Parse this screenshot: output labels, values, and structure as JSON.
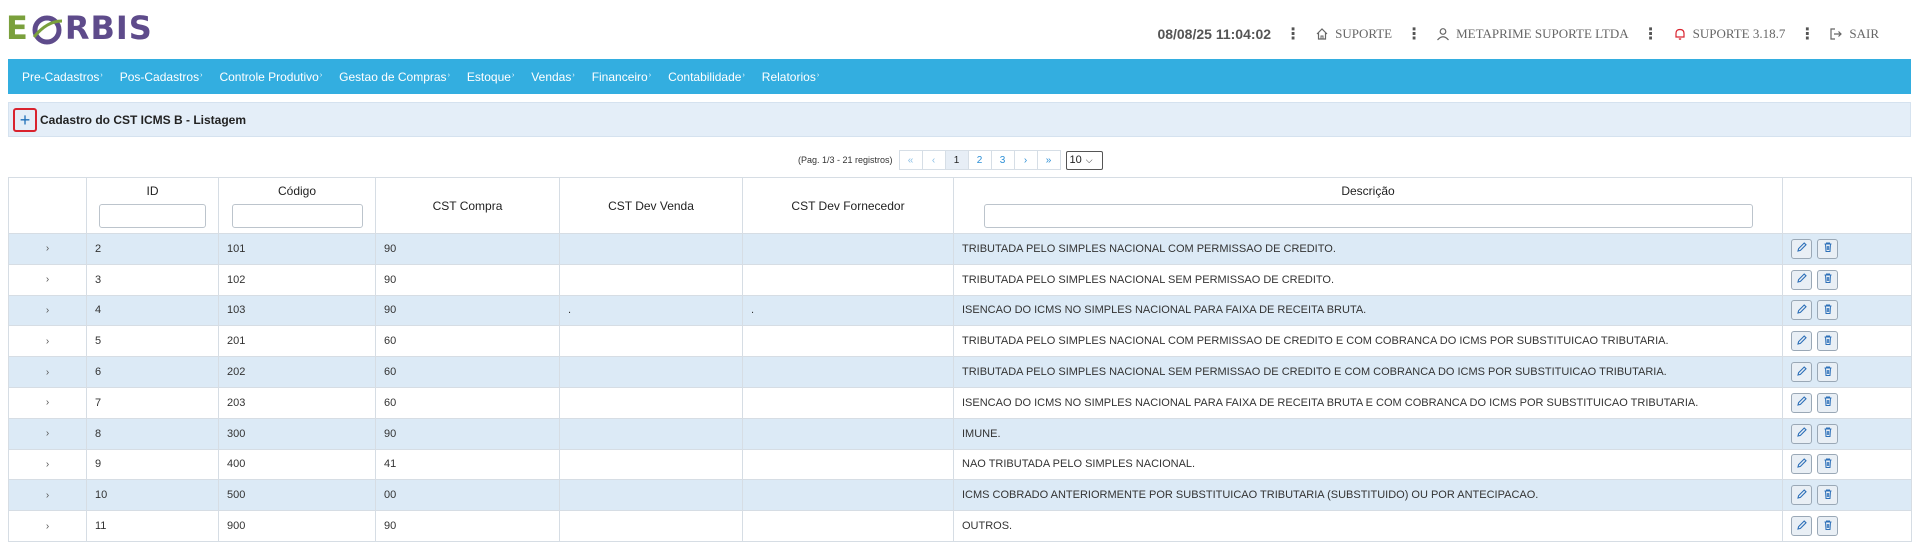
{
  "logo": {
    "letter_e": "E",
    "rest": "RBIS"
  },
  "header": {
    "datetime": "08/08/25 11:04:02",
    "support_label": "SUPORTE",
    "company": "METAPRIME SUPORTE LTDA",
    "version": "SUPORTE 3.18.7",
    "logout": "SAIR"
  },
  "menu": [
    {
      "label": "Pre-Cadastros"
    },
    {
      "label": "Pos-Cadastros"
    },
    {
      "label": "Controle Produtivo"
    },
    {
      "label": "Gestao de Compras"
    },
    {
      "label": "Estoque"
    },
    {
      "label": "Vendas"
    },
    {
      "label": "Financeiro"
    },
    {
      "label": "Contabilidade"
    },
    {
      "label": "Relatorios"
    }
  ],
  "page": {
    "add_symbol": "+",
    "title": "Cadastro do CST ICMS B - Listagem"
  },
  "pager": {
    "info": "(Pag. 1/3 - 21 registros)",
    "first": "«",
    "prev": "‹",
    "pages": [
      "1",
      "2",
      "3"
    ],
    "current_page": "1",
    "next": "›",
    "last": "»",
    "page_size": "10"
  },
  "table": {
    "headers": {
      "id": "ID",
      "codigo": "Código",
      "cst_compra": "CST Compra",
      "cst_dev_venda": "CST Dev Venda",
      "cst_dev_fornecedor": "CST Dev Fornecedor",
      "descricao": "Descrição"
    },
    "rows": [
      {
        "id": "2",
        "codigo": "101",
        "cst_compra": "90",
        "cst_dev_venda": "",
        "cst_dev_fornecedor": "",
        "descricao": "TRIBUTADA PELO SIMPLES NACIONAL COM PERMISSAO DE CREDITO."
      },
      {
        "id": "3",
        "codigo": "102",
        "cst_compra": "90",
        "cst_dev_venda": "",
        "cst_dev_fornecedor": "",
        "descricao": "TRIBUTADA PELO SIMPLES NACIONAL SEM PERMISSAO DE CREDITO."
      },
      {
        "id": "4",
        "codigo": "103",
        "cst_compra": "90",
        "cst_dev_venda": ".",
        "cst_dev_fornecedor": ".",
        "descricao": "ISENCAO DO ICMS NO SIMPLES NACIONAL PARA FAIXA DE RECEITA BRUTA."
      },
      {
        "id": "5",
        "codigo": "201",
        "cst_compra": "60",
        "cst_dev_venda": "",
        "cst_dev_fornecedor": "",
        "descricao": "TRIBUTADA PELO SIMPLES NACIONAL COM PERMISSAO DE CREDITO E COM COBRANCA DO ICMS POR SUBSTITUICAO TRIBUTARIA."
      },
      {
        "id": "6",
        "codigo": "202",
        "cst_compra": "60",
        "cst_dev_venda": "",
        "cst_dev_fornecedor": "",
        "descricao": "TRIBUTADA PELO SIMPLES NACIONAL SEM PERMISSAO DE CREDITO E COM COBRANCA DO ICMS POR SUBSTITUICAO TRIBUTARIA."
      },
      {
        "id": "7",
        "codigo": "203",
        "cst_compra": "60",
        "cst_dev_venda": "",
        "cst_dev_fornecedor": "",
        "descricao": "ISENCAO DO ICMS NO SIMPLES NACIONAL PARA FAIXA DE RECEITA BRUTA E COM COBRANCA DO ICMS POR SUBSTITUICAO TRIBUTARIA."
      },
      {
        "id": "8",
        "codigo": "300",
        "cst_compra": "90",
        "cst_dev_venda": "",
        "cst_dev_fornecedor": "",
        "descricao": "IMUNE."
      },
      {
        "id": "9",
        "codigo": "400",
        "cst_compra": "41",
        "cst_dev_venda": "",
        "cst_dev_fornecedor": "",
        "descricao": "NAO TRIBUTADA PELO SIMPLES NACIONAL."
      },
      {
        "id": "10",
        "codigo": "500",
        "cst_compra": "00",
        "cst_dev_venda": "",
        "cst_dev_fornecedor": "",
        "descricao": "ICMS COBRADO ANTERIORMENTE POR SUBSTITUICAO TRIBUTARIA (SUBSTITUIDO) OU POR ANTECIPACAO."
      },
      {
        "id": "11",
        "codigo": "900",
        "cst_compra": "90",
        "cst_dev_venda": "",
        "cst_dev_fornecedor": "",
        "descricao": "OUTROS."
      }
    ]
  },
  "icons": {
    "expand": "chevron-right-icon",
    "edit": "pencil-icon",
    "delete": "trash-icon"
  },
  "colors": {
    "menu_bg": "#33aee0",
    "row_alt": "#dceaf6",
    "logo_purple": "#5e4b8b",
    "logo_green": "#7aa03c",
    "alert_red": "#d9232e"
  }
}
